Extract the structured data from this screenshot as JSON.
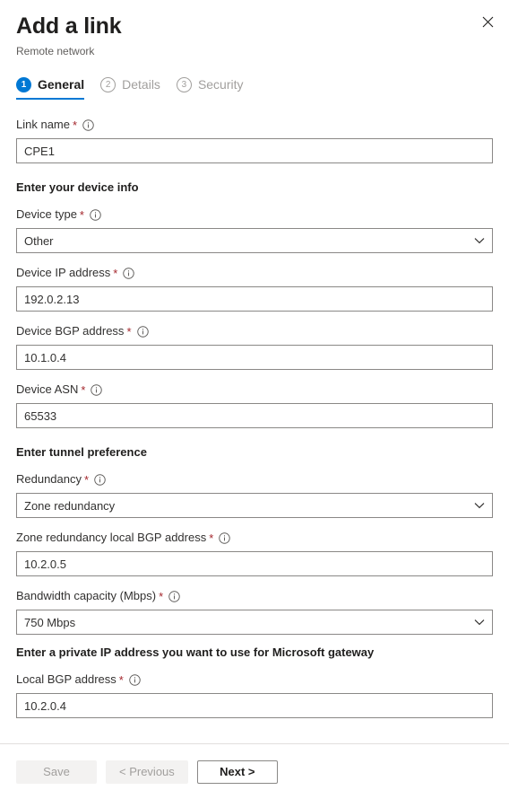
{
  "header": {
    "title": "Add a link",
    "subtitle": "Remote network",
    "close_icon": "close-icon"
  },
  "steps": [
    {
      "num": "1",
      "label": "General",
      "state": "active"
    },
    {
      "num": "2",
      "label": "Details",
      "state": "inactive"
    },
    {
      "num": "3",
      "label": "Security",
      "state": "inactive"
    }
  ],
  "sections": {
    "device_info": "Enter your device info",
    "tunnel_preference": "Enter tunnel preference",
    "private_ip": "Enter a private IP address you want to use for Microsoft gateway"
  },
  "fields": {
    "link_name": {
      "label": "Link name",
      "required": "*",
      "value": "CPE1"
    },
    "device_type": {
      "label": "Device type",
      "required": "*",
      "value": "Other"
    },
    "device_ip": {
      "label": "Device IP address",
      "required": "*",
      "value": "192.0.2.13"
    },
    "device_bgp": {
      "label": "Device BGP address",
      "required": "*",
      "value": "10.1.0.4"
    },
    "device_asn": {
      "label": "Device ASN",
      "required": "*",
      "value": "65533"
    },
    "redundancy": {
      "label": "Redundancy",
      "required": "*",
      "value": "Zone redundancy"
    },
    "zone_redundancy_bgp": {
      "label": "Zone redundancy local BGP address",
      "required": "*",
      "value": "10.2.0.5"
    },
    "bandwidth": {
      "label": "Bandwidth capacity (Mbps)",
      "required": "*",
      "value": "750 Mbps"
    },
    "local_bgp": {
      "label": "Local BGP address",
      "required": "*",
      "value": "10.2.0.4"
    }
  },
  "footer": {
    "save_label": "Save",
    "previous_label": "< Previous",
    "next_label": "Next >"
  },
  "colors": {
    "accent": "#0078d4",
    "required_star": "#a4262c",
    "border": "#8a8886",
    "disabled_bg": "#f3f2f1",
    "disabled_text": "#a19f9d"
  }
}
